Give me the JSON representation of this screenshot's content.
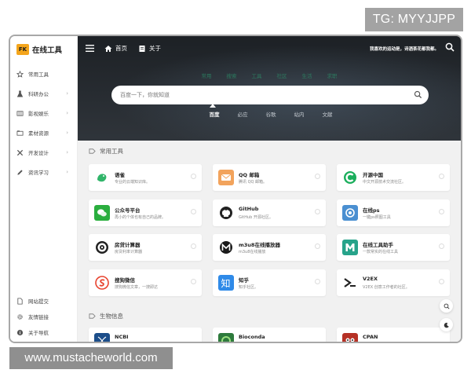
{
  "watermarks": {
    "top": "TG: MYYJJPP",
    "bottom": "www.mustacheworld.com"
  },
  "brand": {
    "badge": "FK",
    "name": "在线工具"
  },
  "sidebar": {
    "items": [
      {
        "label": "常用工具",
        "icon": "star-icon",
        "has_arrow": false
      },
      {
        "label": "科研办公",
        "icon": "flask-icon",
        "has_arrow": true
      },
      {
        "label": "影视娱乐",
        "icon": "film-icon",
        "has_arrow": true
      },
      {
        "label": "素材资源",
        "icon": "folder-icon",
        "has_arrow": true
      },
      {
        "label": "开发设计",
        "icon": "tools-icon",
        "has_arrow": true
      },
      {
        "label": "资讯学习",
        "icon": "pencil-icon",
        "has_arrow": true
      }
    ],
    "bottom_items": [
      {
        "label": "网站提交",
        "icon": "file-icon"
      },
      {
        "label": "友情链接",
        "icon": "gear-icon"
      },
      {
        "label": "关于导航",
        "icon": "info-icon"
      }
    ],
    "arrow": "›"
  },
  "topbar": {
    "home_label": "首页",
    "about_label": "关于",
    "right_text": "我喜欢的运动是，诗酒茶花都我都。"
  },
  "hero": {
    "category_tabs": [
      "常用",
      "搜索",
      "工具",
      "社区",
      "生活",
      "求职"
    ],
    "search_placeholder": "百度一下，你就知道",
    "engine_tabs": [
      "百度",
      "必应",
      "谷歌",
      "站内",
      "文献"
    ],
    "active_engine": "百度"
  },
  "sections": [
    {
      "title": "常用工具",
      "cards": [
        {
          "title": "语雀",
          "desc": "专业的云端知识库。",
          "icon": "yuque-icon",
          "color": "#ffffff"
        },
        {
          "title": "QQ 邮箱",
          "desc": "腾讯 QQ 邮箱。",
          "icon": "mail-icon",
          "color": "#f2a35c"
        },
        {
          "title": "开源中国",
          "desc": "中文开源技术交流社区。",
          "icon": "oschina-icon",
          "color": "#ffffff"
        },
        {
          "title": "公众号平台",
          "desc": "再小的个体也有自己的品牌。",
          "icon": "wechat-icon",
          "color": "#2aae3e"
        },
        {
          "title": "GitHub",
          "desc": "GitHub 开源社区。",
          "icon": "github-icon",
          "color": "#ffffff"
        },
        {
          "title": "在线ps",
          "desc": "一键ps照图工具",
          "icon": "ps-icon",
          "color": "#4a8fd1"
        },
        {
          "title": "房贷计算器",
          "desc": "房贷利率计算器",
          "icon": "target-icon",
          "color": "#ffffff"
        },
        {
          "title": "m3u8在线播放器",
          "desc": "m3u8在线播放",
          "icon": "m3u8-icon",
          "color": "#ffffff"
        },
        {
          "title": "在线工具助手",
          "desc": "一款常实的在线工具",
          "icon": "m-logo-icon",
          "color": "#27a38a"
        },
        {
          "title": "搜狗微信",
          "desc": "搜狗微信文章，一搜即达",
          "icon": "sogou-icon",
          "color": "#ffffff"
        },
        {
          "title": "知乎",
          "desc": "知乎社区。",
          "icon": "zhihu-icon",
          "color": "#2f8ae8"
        },
        {
          "title": "V2EX",
          "desc": "V2EX 创意工作者的社区。",
          "icon": "v2ex-icon",
          "color": "#ffffff"
        }
      ]
    },
    {
      "title": "生物信息",
      "cards": [
        {
          "title": "NCBI",
          "desc": "",
          "icon": "ncbi-icon",
          "color": "#1c4e8a"
        },
        {
          "title": "Bioconda",
          "desc": "",
          "icon": "bioconda-icon",
          "color": "#2d7a3c"
        },
        {
          "title": "CPAN",
          "desc": "",
          "icon": "cpan-icon",
          "color": "#b53125"
        }
      ]
    }
  ],
  "colors": {
    "accent_green": "#2b8a66",
    "logo_orange": "#f4a51c",
    "hero_bg": "#2a2e33"
  }
}
